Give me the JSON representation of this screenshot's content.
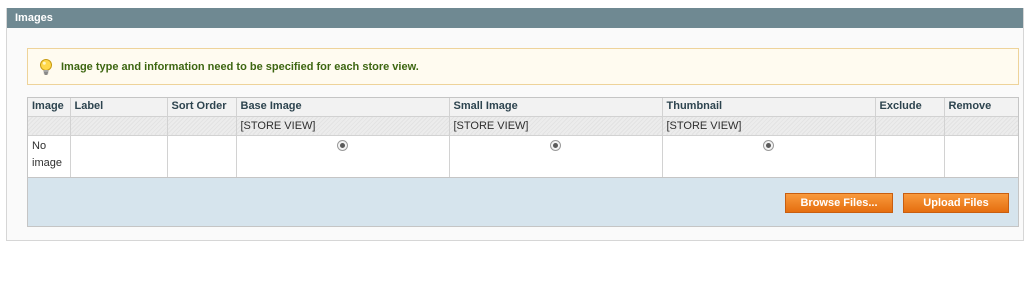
{
  "section": {
    "title": "Images"
  },
  "notice": {
    "icon": "lightbulb-icon",
    "text": "Image type and information need to be specified for each store view."
  },
  "grid": {
    "columns": [
      "Image",
      "Label",
      "Sort Order",
      "Base Image",
      "Small Image",
      "Thumbnail",
      "Exclude",
      "Remove"
    ],
    "scope_label": "[STORE VIEW]",
    "row": {
      "image": "No image"
    }
  },
  "buttons": {
    "browse": "Browse Files...",
    "upload": "Upload Files"
  },
  "colors": {
    "header_bg": "#6f8992",
    "button_orange": "#f18324",
    "notice_bg": "#fffbf0",
    "grid_footer_bg": "#d6e4ed"
  }
}
